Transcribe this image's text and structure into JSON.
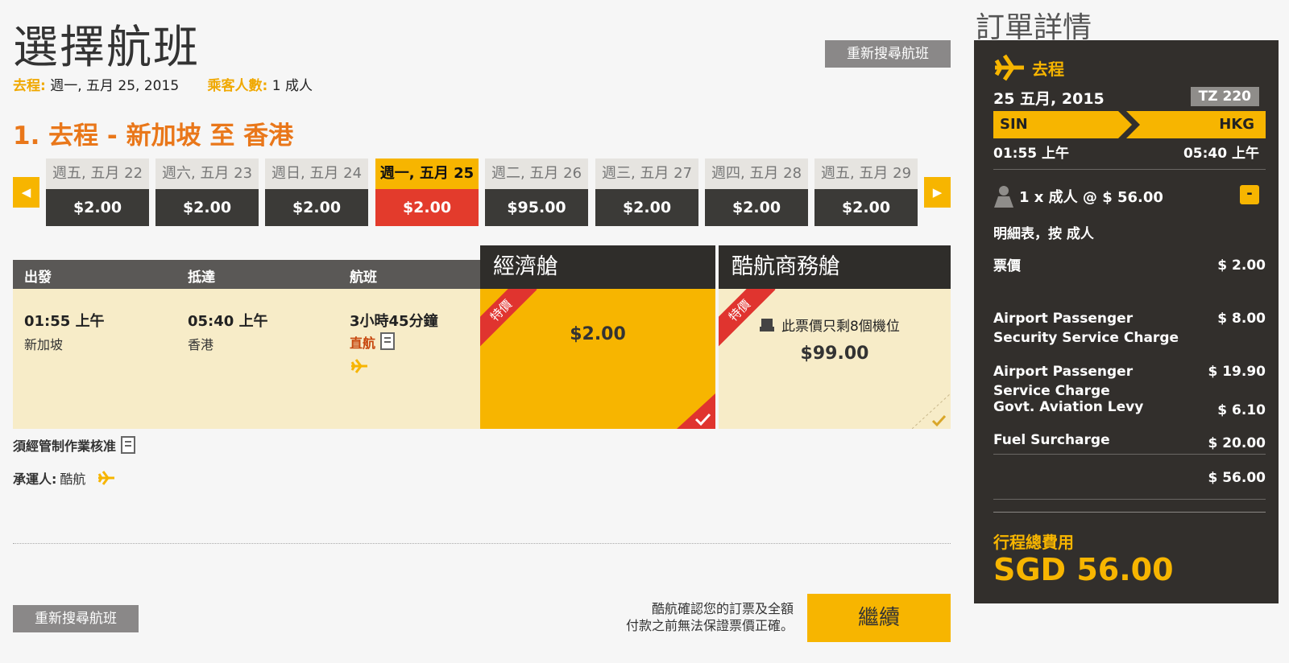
{
  "header": {
    "title": "選擇航班",
    "research_label": "重新搜尋航班",
    "depart_label": "去程:",
    "depart_value": "週一, 五月 25, 2015",
    "passengers_label": "乘客人數:",
    "passengers_value": "1 成人"
  },
  "section": {
    "title": "1. 去程 - 新加坡 至 香港"
  },
  "date_strip": {
    "prev_icon": "◀",
    "next_icon": "▶",
    "dates": [
      {
        "day": "週五, 五月 22",
        "price": "$2.00",
        "selected": false
      },
      {
        "day": "週六, 五月 23",
        "price": "$2.00",
        "selected": false
      },
      {
        "day": "週日, 五月 24",
        "price": "$2.00",
        "selected": false
      },
      {
        "day": "週一, 五月 25",
        "price": "$2.00",
        "selected": true
      },
      {
        "day": "週二, 五月 26",
        "price": "$95.00",
        "selected": false
      },
      {
        "day": "週三, 五月 27",
        "price": "$2.00",
        "selected": false
      },
      {
        "day": "週四, 五月 28",
        "price": "$2.00",
        "selected": false
      },
      {
        "day": "週五, 五月 29",
        "price": "$2.00",
        "selected": false
      }
    ]
  },
  "flight": {
    "col_depart": "出發",
    "col_arrive": "抵達",
    "col_flight": "航班",
    "depart_time": "01:55 上午",
    "depart_city": "新加坡",
    "arrive_time": "05:40 上午",
    "arrive_city": "香港",
    "duration": "3小時45分鐘",
    "type": "直航"
  },
  "fares": {
    "economy": {
      "name": "經濟艙",
      "price": "$2.00",
      "ribbon": "特價"
    },
    "business": {
      "name": "酷航商務艙",
      "price": "$99.00",
      "ribbon": "特價",
      "seats_note": "此票價只剩8個機位"
    }
  },
  "notes": {
    "approval": "須經管制作業核准",
    "carrier_label": "承運人:",
    "carrier_value": "酷航"
  },
  "footer": {
    "research_label": "重新搜尋航班",
    "disclaimer_line1": "酷航確認您的訂票及全額",
    "disclaimer_line2": "付款之前無法保證票價正確。",
    "continue_label": "繼續"
  },
  "summary": {
    "title": "訂單詳情",
    "leg_label": "去程",
    "date": "25 五月, 2015",
    "flight_no": "TZ 220",
    "origin": "SIN",
    "destination": "HKG",
    "depart_time": "01:55 上午",
    "arrive_time": "05:40 上午",
    "pax_line": "1 x 成人 @ $ 56.00",
    "collapse_icon": "-",
    "breakdown_label": "明細表，按 成人",
    "items": [
      {
        "label": "票價",
        "amount": "$ 2.00"
      },
      {
        "label": "Airport Passenger\nSecurity Service Charge",
        "amount": "$ 8.00"
      },
      {
        "label": "Airport Passenger\nService Charge",
        "amount": "$ 19.90"
      },
      {
        "label": "Govt. Aviation Levy",
        "amount": "$ 6.10"
      },
      {
        "label": "Fuel Surcharge",
        "amount": "$ 20.00"
      }
    ],
    "subtotal": "$ 56.00",
    "total_label": "行程總費用",
    "total_value": "SGD 56.00"
  },
  "colors": {
    "accent_yellow": "#f7b500",
    "accent_orange": "#e9771a",
    "selected_red": "#e33b2c",
    "panel_dark": "#322f2c"
  }
}
